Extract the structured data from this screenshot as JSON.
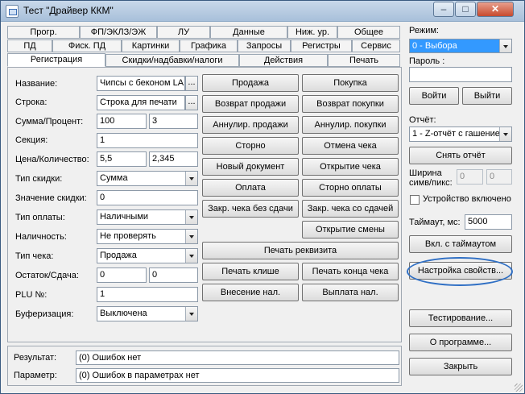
{
  "window": {
    "title": "Тест \"Драйвер ККМ\"",
    "minimize": "–",
    "maximize": "□",
    "close": "✕"
  },
  "tabs": {
    "row1": [
      "Прогр.",
      "ФП/ЭКЛЗ/ЭЖ",
      "ЛУ",
      "Данные",
      "Ниж. ур.",
      "Общее"
    ],
    "row2": [
      "ПД",
      "Фиск. ПД",
      "Картинки",
      "Графика",
      "Запросы",
      "Регистры",
      "Сервис"
    ],
    "row3": [
      "Регистрация",
      "Скидки/надбавки/налоги",
      "Действия",
      "Печать"
    ]
  },
  "form": {
    "name_label": "Название:",
    "name_value": "Чипсы с беконом LA",
    "string_label": "Строка:",
    "string_value": "Строка для печати",
    "dots": "...",
    "sum_label": "Сумма/Процент:",
    "sum_value": "100",
    "percent_value": "3",
    "section_label": "Секция:",
    "section_value": "1",
    "price_label": "Цена/Количество:",
    "price_value": "5,5",
    "quantity_value": "2,345",
    "discount_type_label": "Тип скидки:",
    "discount_type_value": "Сумма",
    "discount_value_label": "Значение скидки:",
    "discount_value": "0",
    "payment_type_label": "Тип оплаты:",
    "payment_type_value": "Наличными",
    "cash_label": "Наличность:",
    "cash_value": "Не проверять",
    "receipt_type_label": "Тип чека:",
    "receipt_type_value": "Продажа",
    "remainder_label": "Остаток/Сдача:",
    "remainder_value": "0",
    "change_value": "0",
    "plu_label": "PLU №:",
    "plu_value": "1",
    "buffering_label": "Буферизация:",
    "buffering_value": "Выключена"
  },
  "actions": {
    "sale": "Продажа",
    "purchase": "Покупка",
    "return_sale": "Возврат продажи",
    "return_purchase": "Возврат покупки",
    "annul_sale": "Аннулир. продажи",
    "annul_purchase": "Аннулир. покупки",
    "storno": "Сторно",
    "cancel_check": "Отмена чека",
    "new_document": "Новый документ",
    "open_check": "Открытие чека",
    "payment": "Оплата",
    "storno_payment": "Сторно оплаты",
    "close_no_change": "Закр. чека без сдачи",
    "close_with_change": "Закр. чека со сдачей",
    "open_shift": "Открытие смены",
    "print_requisite": "Печать реквизита",
    "print_header": "Печать клише",
    "print_footer": "Печать конца чека",
    "cash_in": "Внесение нал.",
    "cash_out": "Выплата нал."
  },
  "status": {
    "result_label": "Результат:",
    "result_value": "(0) Ошибок нет",
    "param_label": "Параметр:",
    "param_value": "(0) Ошибок в параметрах нет"
  },
  "right": {
    "mode_label": "Режим:",
    "mode_value": "0 - Выбора",
    "password_label": "Пароль :",
    "password_value": "",
    "login": "Войти",
    "logout": "Выйти",
    "report_label": "Отчёт:",
    "report_value": "1 - Z-отчёт с гашение",
    "take_report": "Снять отчёт",
    "width_label_1": "Ширина",
    "width_label_2": "симв/пикс:",
    "width_symbols": "0",
    "width_pixels": "0",
    "device_enabled": "Устройство включено",
    "timeout_label": "Таймаут, мс:",
    "timeout_value": "5000",
    "enable_timeout": "Вкл. с таймаутом",
    "properties": "Настройка свойств...",
    "testing": "Тестирование...",
    "about": "О программе...",
    "close": "Закрыть"
  },
  "colors": {
    "mode_highlight": "#3399ff",
    "annotation": "#2f6fc4"
  }
}
